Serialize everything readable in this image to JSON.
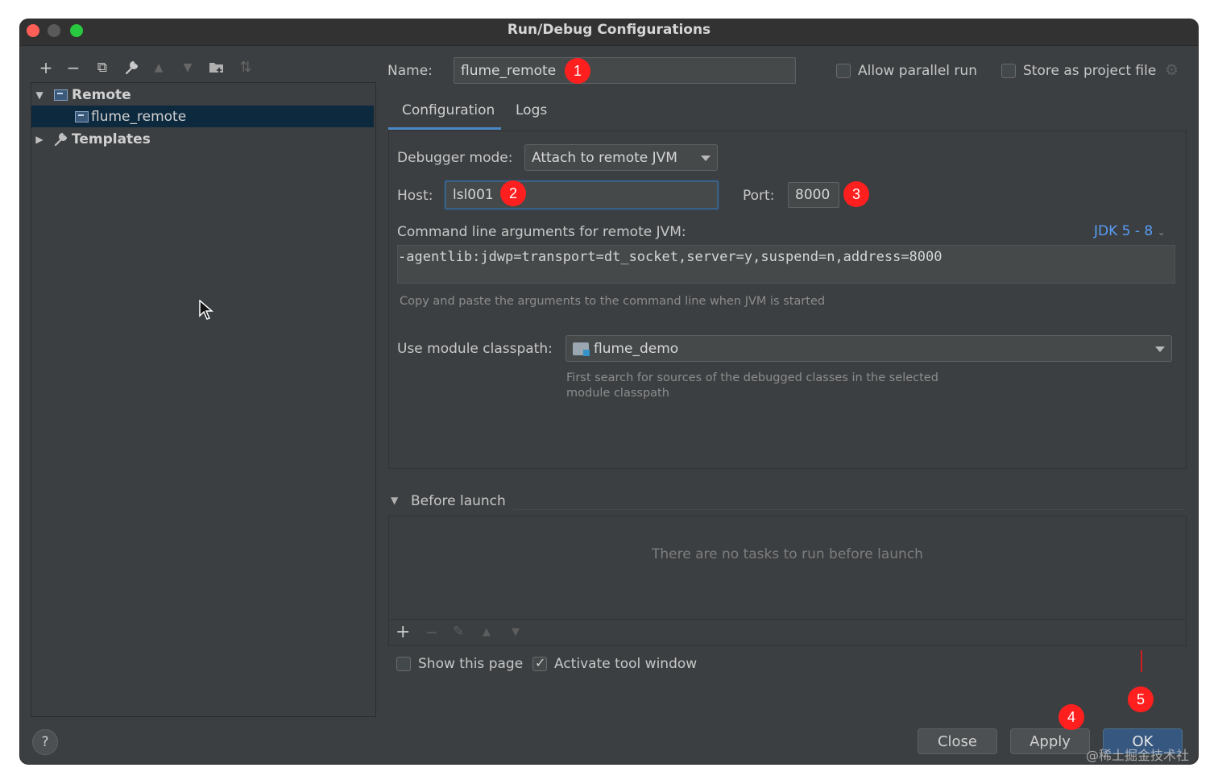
{
  "window": {
    "title": "Run/Debug Configurations"
  },
  "left_panel": {
    "toolbar_icons": [
      "add-icon",
      "remove-icon",
      "copy-icon",
      "wrench-icon",
      "move-up-icon",
      "move-down-icon",
      "new-folder-icon",
      "sort-icon"
    ],
    "toolbar_glyphs": {
      "add": "+",
      "remove": "−",
      "copy": "⧉",
      "wrench": "🔧",
      "up": "▲",
      "down": "▼",
      "folder": "▰",
      "sort": "⇅"
    },
    "tree": [
      {
        "label": "Remote",
        "expanded": true,
        "children": [
          {
            "label": "flume_remote",
            "selected": true
          }
        ]
      },
      {
        "label": "Templates",
        "expanded": false
      }
    ],
    "help": "?"
  },
  "header": {
    "name_label": "Name:",
    "name_value": "flume_remote",
    "allow_parallel_label": "Allow parallel run",
    "allow_parallel_checked": false,
    "store_label": "Store as project file",
    "store_checked": false
  },
  "tabs": [
    {
      "label": "Configuration",
      "active": true
    },
    {
      "label": "Logs",
      "active": false
    }
  ],
  "config": {
    "debugger_mode_label": "Debugger mode:",
    "debugger_mode_value": "Attach to remote JVM",
    "host_label": "Host:",
    "host_value": "lsl001",
    "port_label": "Port:",
    "port_value": "8000",
    "cmd_label": "Command line arguments for remote JVM:",
    "jdk_label": "JDK 5 - 8",
    "cmd_value": "-agentlib:jdwp=transport=dt_socket,server=y,suspend=n,address=8000",
    "cmd_hint": "Copy and paste the arguments to the command line when JVM is started",
    "module_label": "Use module classpath:",
    "module_value": "flume_demo",
    "module_hint_1": "First search for sources of the debugged classes in the selected",
    "module_hint_2": "module classpath"
  },
  "before_launch": {
    "title": "Before launch",
    "empty_text": "There are no tasks to run before launch",
    "toolbar_glyphs": {
      "add": "+",
      "remove": "−",
      "edit": "✎",
      "up": "▲",
      "down": "▼"
    }
  },
  "options": {
    "show_page_label": "Show this page",
    "show_page_checked": false,
    "activate_label": "Activate tool window",
    "activate_checked": true
  },
  "buttons": {
    "close": "Close",
    "apply": "Apply",
    "ok": "OK"
  },
  "annotations": [
    "1",
    "2",
    "3",
    "4",
    "5"
  ],
  "watermark": "@稀土掘金技术社区",
  "colors": {
    "accent": "#4a88c7",
    "selection": "#0d293e",
    "badge": "#ff1f1f",
    "link": "#589df6"
  }
}
